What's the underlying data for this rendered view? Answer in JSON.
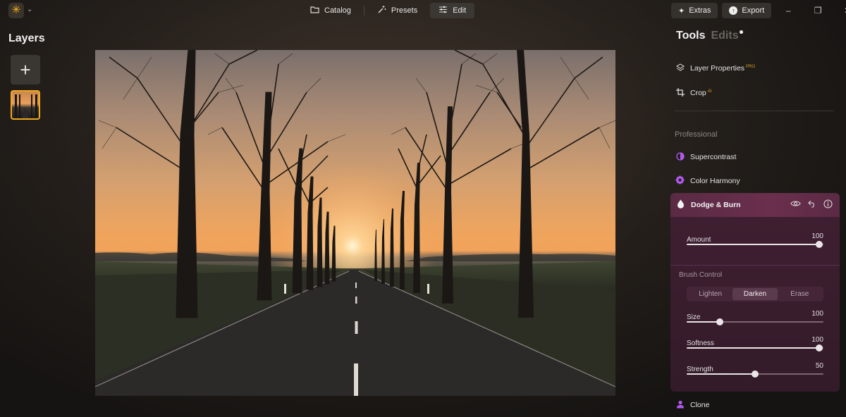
{
  "topbar": {
    "logo_icon": "sun-logo-icon",
    "nav": [
      {
        "label": "Catalog",
        "icon": "folder-icon"
      },
      {
        "label": "Presets",
        "icon": "magic-wand-icon"
      },
      {
        "label": "Edit",
        "icon": "sliders-icon",
        "active": true
      }
    ],
    "extras_label": "Extras",
    "export_label": "Export"
  },
  "layers": {
    "title": "Layers",
    "add_symbol": "+"
  },
  "right_panel": {
    "tabs": [
      {
        "label": "Tools",
        "active": true
      },
      {
        "label": "Edits",
        "active": false,
        "has_dot": true
      }
    ],
    "quick_tools": [
      {
        "label": "Layer Properties",
        "badge": "PRO",
        "icon": "layers-icon"
      },
      {
        "label": "Crop",
        "badge": "AI",
        "icon": "crop-icon"
      }
    ],
    "section_title": "Professional",
    "pro_tools": [
      {
        "label": "Supercontrast",
        "icon": "half-circle-icon"
      },
      {
        "label": "Color Harmony",
        "icon": "flower-icon"
      }
    ],
    "active_tool": {
      "name": "Dodge & Burn",
      "icon": "drop-icon",
      "amount_label": "Amount",
      "amount_value": "100",
      "amount_fraction": 0.97,
      "brush_title": "Brush Control",
      "modes": [
        "Lighten",
        "Darken",
        "Erase"
      ],
      "active_mode": "Darken",
      "sliders": [
        {
          "label": "Size",
          "value": "100",
          "fraction": 0.24
        },
        {
          "label": "Softness",
          "value": "100",
          "fraction": 0.97
        },
        {
          "label": "Strength",
          "value": "50",
          "fraction": 0.5
        }
      ]
    },
    "bottom_tool": {
      "label": "Clone",
      "icon": "person-stamp-icon"
    }
  },
  "colors": {
    "accent_orange": "#f0a81f",
    "accent_purple": "#b259f0",
    "active_tool_bg": "#4a2438"
  }
}
